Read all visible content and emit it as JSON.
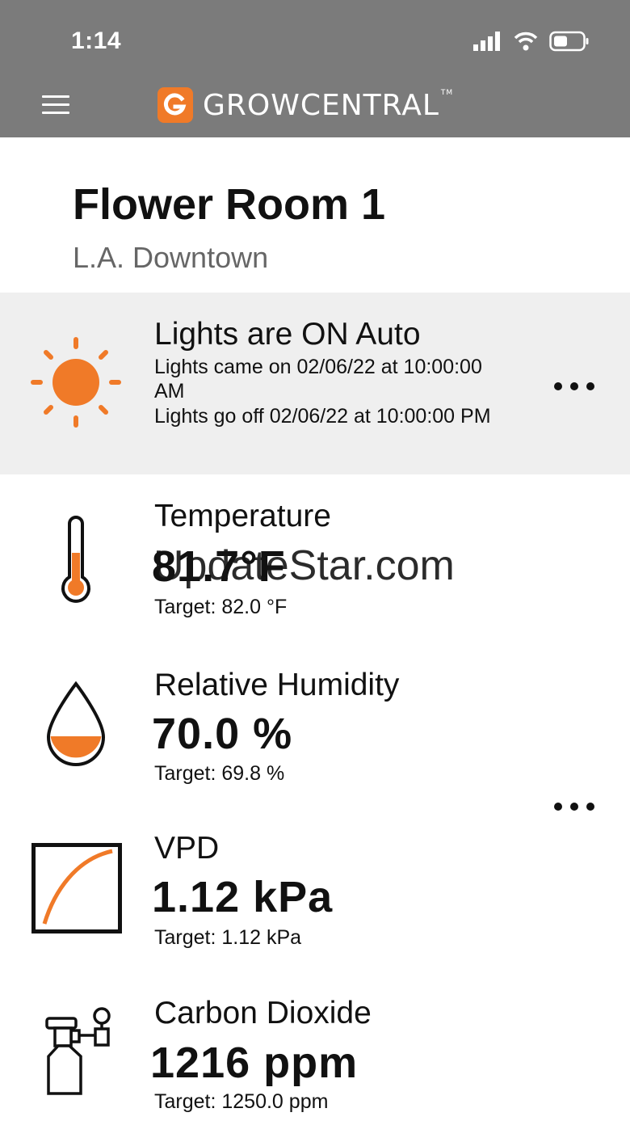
{
  "status_bar": {
    "time": "1:14"
  },
  "header": {
    "brand": "GROWCENTRAL",
    "brand_mark": "G",
    "tm": "TM"
  },
  "room": {
    "title": "Flower Room 1",
    "location": "L.A. Downtown"
  },
  "lights": {
    "title": "Lights are ON Auto",
    "detail_on": "Lights came on 02/06/22 at 10:00:00 AM",
    "detail_off": "Lights go off 02/06/22 at 10:00:00 PM",
    "icon": "sun-icon"
  },
  "metrics": [
    {
      "label": "Temperature",
      "value": "81.7°F",
      "target": "Target: 82.0 °F",
      "icon": "thermometer-icon"
    },
    {
      "label": "Relative Humidity",
      "value": "70.0 %",
      "target": "Target: 69.8 %",
      "icon": "water-drop-icon"
    },
    {
      "label": "VPD",
      "value": "1.12 kPa",
      "target": "Target: 1.12 kPa",
      "icon": "vpd-curve-icon"
    },
    {
      "label": "Carbon Dioxide",
      "value": "1216 ppm",
      "target": "Target: 1250.0 ppm",
      "icon": "co2-tank-icon"
    }
  ],
  "watermark": "UpdateStar.com",
  "colors": {
    "accent": "#f07a28",
    "header_bg": "#7b7b7b",
    "lights_bg": "#efefef"
  }
}
